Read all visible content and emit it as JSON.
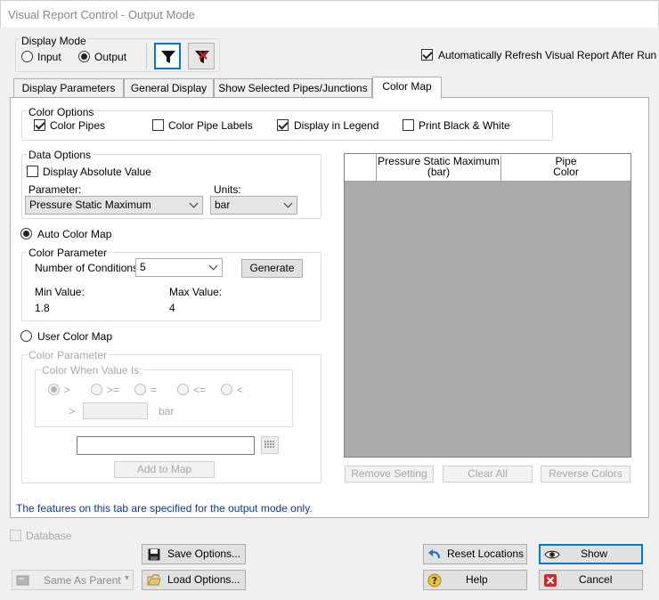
{
  "window": {
    "title": "Visual Report Control - Output Mode"
  },
  "display_mode": {
    "label": "Display Mode",
    "input_label": "Input",
    "output_label": "Output",
    "selected": "Output"
  },
  "auto_refresh": {
    "label": "Automatically Refresh Visual Report After Run",
    "checked": true
  },
  "tabs": [
    {
      "label": "Display Parameters",
      "active": false
    },
    {
      "label": "General Display",
      "active": false
    },
    {
      "label": "Show Selected Pipes/Junctions",
      "active": false
    },
    {
      "label": "Color Map",
      "active": true
    }
  ],
  "color_options": {
    "label": "Color Options",
    "color_pipes": {
      "label": "Color Pipes",
      "checked": true
    },
    "color_pipe_labels": {
      "label": "Color Pipe Labels",
      "checked": false
    },
    "display_in_legend": {
      "label": "Display in Legend",
      "checked": true
    },
    "print_bw": {
      "label": "Print Black & White",
      "checked": false
    }
  },
  "data_options": {
    "label": "Data Options",
    "display_absolute": {
      "label": "Display Absolute Value",
      "checked": false
    },
    "parameter_label": "Parameter:",
    "parameter_value": "Pressure Static Maximum",
    "units_label": "Units:",
    "units_value": "bar"
  },
  "auto_color_map": {
    "label": "Auto Color Map",
    "selected": true,
    "color_parameter_label": "Color Parameter",
    "num_conditions_label": "Number of Conditions:",
    "num_conditions_value": "5",
    "generate_label": "Generate",
    "min_label": "Min Value:",
    "min_value": "1.8",
    "max_label": "Max Value:",
    "max_value": "4"
  },
  "user_color_map": {
    "label": "User Color Map",
    "selected": false,
    "color_parameter_label": "Color Parameter",
    "color_when_label": "Color When Value Is:",
    "ops": [
      ">",
      ">=",
      "=",
      "<=",
      "<"
    ],
    "selected_op": ">",
    "compare_symbol": ">",
    "unit": "bar",
    "add_to_map_label": "Add to Map"
  },
  "table": {
    "col1_line1": "Pressure Static Maximum",
    "col1_line2": "(bar)",
    "col2_line1": "Pipe",
    "col2_line2": "Color",
    "remove_label": "Remove Setting",
    "clear_label": "Clear All",
    "reverse_label": "Reverse Colors"
  },
  "footer_note": "The features on this tab are specified for the output mode only.",
  "bottom": {
    "database_label": "Database",
    "same_as_parent_label": "Same As Parent",
    "save_options_label": "Save Options...",
    "load_options_label": "Load Options...",
    "reset_locations_label": "Reset Locations",
    "help_label": "Help",
    "show_label": "Show",
    "cancel_label": "Cancel"
  },
  "colors": {
    "accent": "#0078d7",
    "grid_bg": "#ababab",
    "note_text": "#0b3a8c"
  }
}
